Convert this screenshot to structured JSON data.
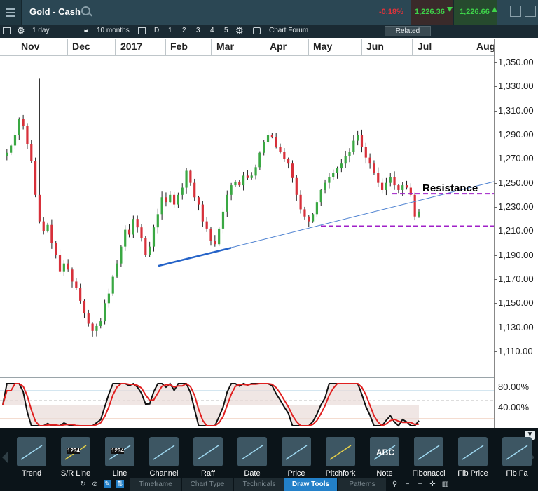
{
  "header": {
    "title": "Gold - Cash",
    "change": "-0.18%",
    "sell_price": "1,226.36",
    "buy_price": "1,226.66",
    "up_color": "#3ed34a",
    "down_color": "#e0333a"
  },
  "toolbar": {
    "interval": "1 day",
    "range": "10 months",
    "periods": [
      "D",
      "1",
      "2",
      "3",
      "4",
      "5"
    ],
    "chart_forum": "Chart Forum",
    "related": "Related"
  },
  "time_axis": {
    "months": [
      "Nov",
      "Dec",
      "2017",
      "Feb",
      "Mar",
      "Apr",
      "May",
      "Jun",
      "Jul",
      "Aug"
    ]
  },
  "price_axis": {
    "labels": [
      "1,350.00",
      "1,330.00",
      "1,310.00",
      "1,290.00",
      "1,270.00",
      "1,250.00",
      "1,230.00",
      "1,210.00",
      "1,190.00",
      "1,170.00",
      "1,150.00",
      "1,130.00",
      "1,110.00"
    ]
  },
  "annotation": {
    "resistance": "Resistance"
  },
  "stochastic": {
    "labels": [
      "80.00%",
      "40.00%"
    ]
  },
  "draw_tools": [
    {
      "label": "Trend",
      "icon": "trend-line-icon"
    },
    {
      "label": "S/R Line",
      "icon": "sr-line-icon",
      "tag": "1234"
    },
    {
      "label": "Line",
      "icon": "line-icon",
      "tag": "1234"
    },
    {
      "label": "Channel",
      "icon": "channel-icon"
    },
    {
      "label": "Raff",
      "icon": "raff-icon"
    },
    {
      "label": "Date",
      "icon": "date-icon"
    },
    {
      "label": "Price",
      "icon": "price-icon"
    },
    {
      "label": "Pitchfork",
      "icon": "pitchfork-icon"
    },
    {
      "label": "Note",
      "icon": "note-icon",
      "tag": "ABC"
    },
    {
      "label": "Fibonacci",
      "icon": "fibonacci-icon"
    },
    {
      "label": "Fib Price",
      "icon": "fib-price-icon"
    },
    {
      "label": "Fib Fa",
      "icon": "fib-fan-icon"
    }
  ],
  "bottom_tabs": [
    "Timeframe",
    "Chart Type",
    "Technicals",
    "Draw Tools",
    "Patterns"
  ],
  "active_tab": "Draw Tools",
  "chart_data": {
    "type": "candlestick",
    "title": "Gold - Cash",
    "interval": "1 day",
    "ylim": [
      1100,
      1360
    ],
    "y_ticks": [
      1110,
      1130,
      1150,
      1170,
      1190,
      1210,
      1230,
      1250,
      1270,
      1290,
      1310,
      1330,
      1350
    ],
    "x_ticks": [
      "Nov",
      "Dec",
      "2017",
      "Feb",
      "Mar",
      "Apr",
      "May",
      "Jun",
      "Jul",
      "Aug"
    ],
    "close_path": [
      1272,
      1275,
      1281,
      1290,
      1303,
      1297,
      1282,
      1268,
      1240,
      1218,
      1210,
      1215,
      1200,
      1190,
      1176,
      1183,
      1178,
      1168,
      1163,
      1152,
      1142,
      1133,
      1127,
      1131,
      1135,
      1150,
      1158,
      1172,
      1183,
      1197,
      1211,
      1207,
      1220,
      1213,
      1204,
      1190,
      1197,
      1213,
      1224,
      1238,
      1234,
      1240,
      1232,
      1240,
      1246,
      1260,
      1250,
      1238,
      1232,
      1218,
      1212,
      1202,
      1199,
      1212,
      1226,
      1240,
      1248,
      1251,
      1248,
      1256,
      1254,
      1256,
      1263,
      1275,
      1284,
      1290,
      1288,
      1280,
      1276,
      1270,
      1266,
      1254,
      1240,
      1228,
      1222,
      1218,
      1224,
      1234,
      1244,
      1250,
      1255,
      1258,
      1262,
      1266,
      1272,
      1276,
      1285,
      1290,
      1280,
      1271,
      1266,
      1258,
      1250,
      1244,
      1250,
      1255,
      1248,
      1244,
      1248,
      1246,
      1240,
      1222,
      1226
    ],
    "resistance_level": 1241,
    "support_level": 1214,
    "trendline": {
      "from": [
        "Jan",
        1181
      ],
      "to": [
        "Jun",
        1251
      ]
    },
    "stochastic": {
      "upper": 80,
      "lower": 40,
      "k_range": [
        0,
        100
      ]
    }
  }
}
